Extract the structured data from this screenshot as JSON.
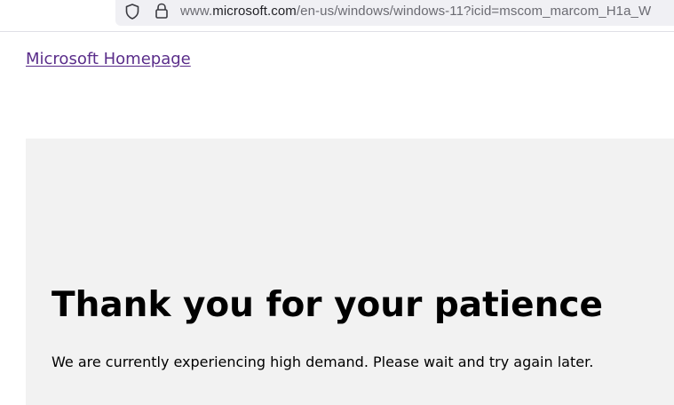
{
  "browser": {
    "url_prefix": "www.",
    "url_domain": "microsoft.com",
    "url_path": "/en-us/windows/windows-11?icid=mscom_marcom_H1a_W",
    "icons": [
      "shield-icon",
      "lock-icon"
    ]
  },
  "page": {
    "home_link": "Microsoft Homepage",
    "headline": "Thank you for your patience",
    "message": "We are currently experiencing high demand. Please wait and try again later."
  },
  "colors": {
    "link": "#5a2d8a",
    "panel_bg": "#f2f2f2",
    "urlbar_bg": "#f0f0f4"
  }
}
